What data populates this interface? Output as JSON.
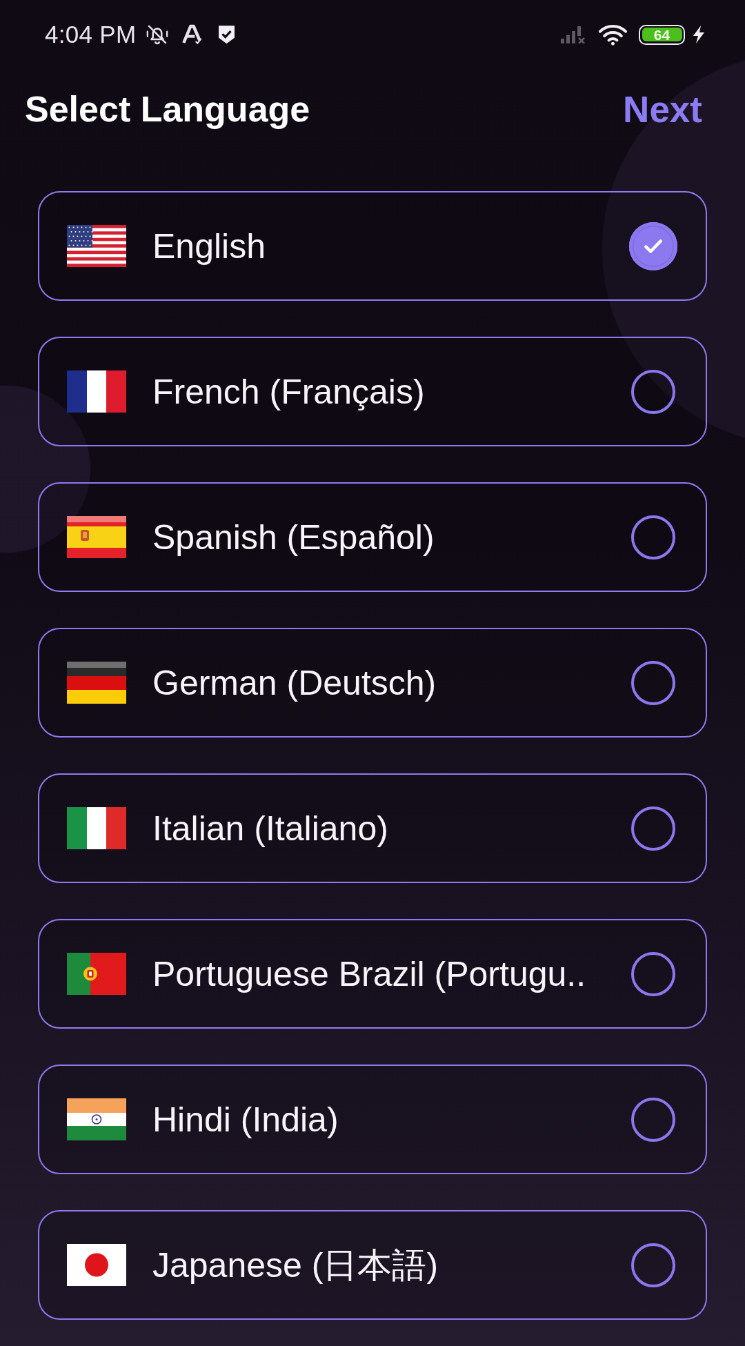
{
  "status_bar": {
    "time": "4:04 PM",
    "battery": "64"
  },
  "header": {
    "title": "Select Language",
    "next_button": "Next"
  },
  "languages": [
    {
      "kind": "us",
      "name": "English",
      "selected": true
    },
    {
      "kind": "france",
      "name": "French (Français)",
      "selected": false
    },
    {
      "kind": "spain",
      "name": "Spanish (Español)",
      "selected": false
    },
    {
      "kind": "germany",
      "name": "German (Deutsch)",
      "selected": false
    },
    {
      "kind": "italy",
      "name": "Italian (Italiano)",
      "selected": false
    },
    {
      "kind": "portugal",
      "name": "Portuguese Brazil (Portugu..",
      "selected": false
    },
    {
      "kind": "india",
      "name": "Hindi (India)",
      "selected": false
    },
    {
      "kind": "japan",
      "name": "Japanese (日本語)",
      "selected": false
    }
  ]
}
